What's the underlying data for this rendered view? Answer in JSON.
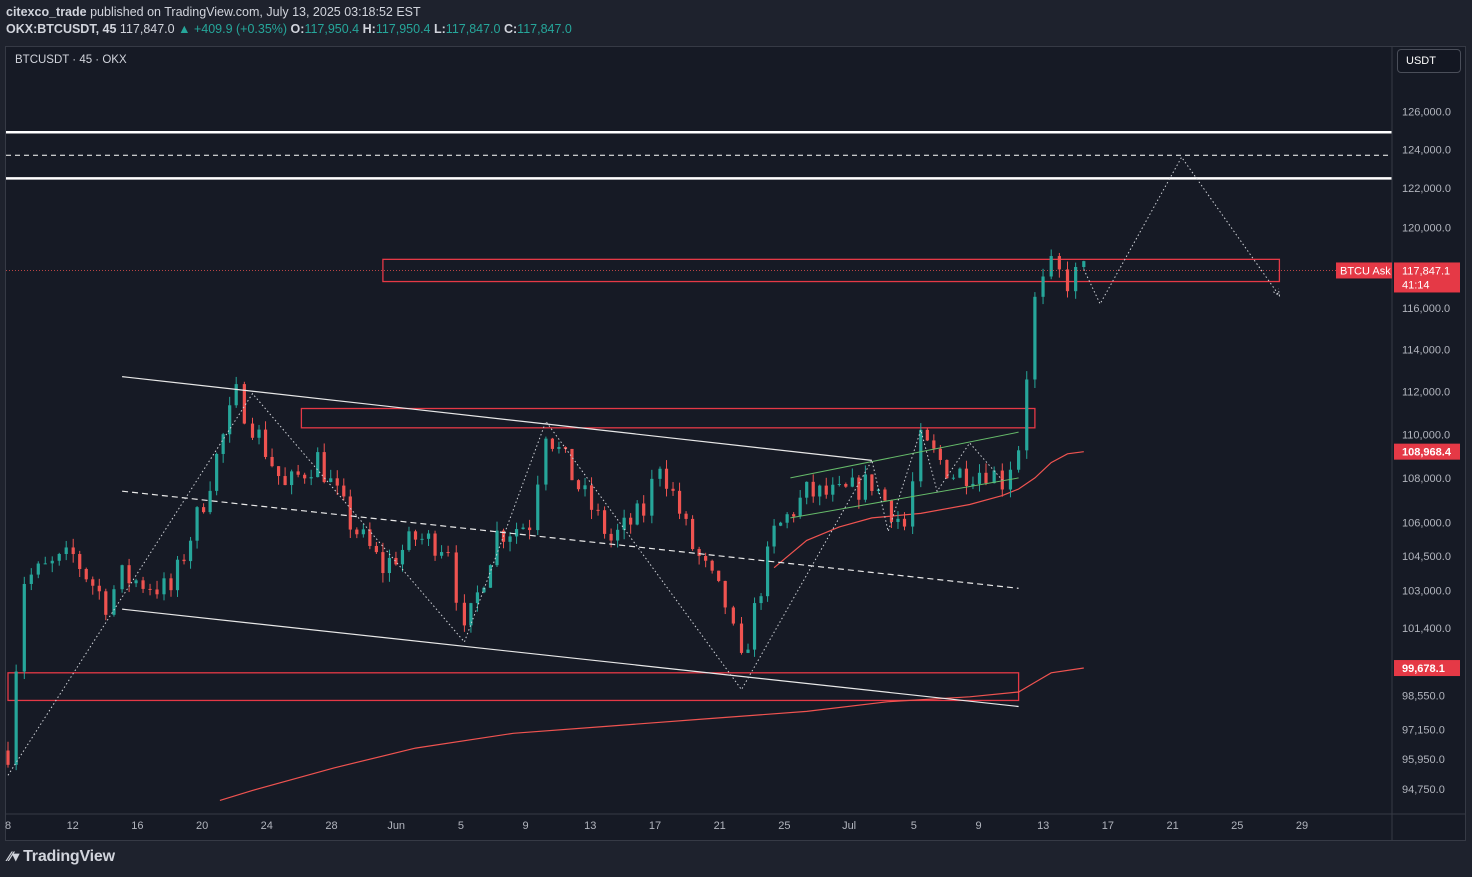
{
  "header": {
    "author": "citexco_trade",
    "published": "published on TradingView.com, July 13, 2025 03:18:52 EST",
    "symbol": "OKX:BTCUSDT, 45",
    "last": "117,847.0",
    "change": "▲ +409.9 (+0.35%)",
    "open_label": "O:",
    "open": "117,950.4",
    "high_label": "H:",
    "high": "117,950.4",
    "low_label": "L:",
    "low": "117,847.0",
    "close_label": "C:",
    "close": "117,847.0"
  },
  "chart_title": "BTCUSDT · 45 · OKX",
  "currency_button": "USDT",
  "footer": {
    "logo": "TradingView"
  },
  "colors": {
    "up": "#26a69a",
    "down": "#ef5350",
    "zone": "#e53946",
    "channel": "#66bb6a",
    "white": "#ffffff",
    "axis_text": "#b2b5be"
  },
  "chart_data": {
    "type": "line",
    "title": "BTCUSDT · 45 · OKX",
    "xlabel": "",
    "ylabel": "",
    "y_scale": "log",
    "ylim": [
      94000,
      128000
    ],
    "y_ticks": [
      "126,000.0",
      "124,000.0",
      "122,000.0",
      "120,000.0",
      "116,000.0",
      "114,000.0",
      "112,000.0",
      "110,000.0",
      "108,000.0",
      "106,000.0",
      "104,500.0",
      "103,000.0",
      "101,400.0",
      "98,550.0",
      "97,150.0",
      "95,950.0",
      "94,750.0"
    ],
    "x_ticks": [
      "8",
      "12",
      "16",
      "20",
      "24",
      "28",
      "Jun",
      "5",
      "9",
      "13",
      "17",
      "21",
      "25",
      "Jul",
      "5",
      "9",
      "13",
      "17",
      "21",
      "25",
      "29"
    ],
    "price_series": {
      "name": "BTCUSDT",
      "x": [
        "2025-05-08",
        "2025-05-09",
        "2025-05-12",
        "2025-05-14",
        "2025-05-15",
        "2025-05-18",
        "2025-05-20",
        "2025-05-22",
        "2025-05-23",
        "2025-05-25",
        "2025-05-27",
        "2025-05-29",
        "2025-05-31",
        "2025-06-02",
        "2025-06-04",
        "2025-06-05",
        "2025-06-07",
        "2025-06-09",
        "2025-06-10",
        "2025-06-12",
        "2025-06-14",
        "2025-06-16",
        "2025-06-17",
        "2025-06-19",
        "2025-06-21",
        "2025-06-22",
        "2025-06-24",
        "2025-06-26",
        "2025-06-28",
        "2025-06-30",
        "2025-07-02",
        "2025-07-03",
        "2025-07-05",
        "2025-07-07",
        "2025-07-08",
        "2025-07-09",
        "2025-07-10",
        "2025-07-11",
        "2025-07-12",
        "2025-07-13"
      ],
      "y": [
        96300,
        103500,
        104500,
        102500,
        103600,
        103000,
        107000,
        111800,
        110500,
        107500,
        108900,
        106000,
        104000,
        105300,
        105000,
        101000,
        105500,
        106000,
        110300,
        107600,
        105200,
        106500,
        108800,
        104900,
        102400,
        99800,
        105500,
        107300,
        107200,
        107800,
        105800,
        109600,
        108200,
        108400,
        107900,
        109500,
        116300,
        117900,
        117300,
        117847
      ]
    },
    "forecast_path": {
      "x": [
        "2025-07-13",
        "2025-07-14",
        "2025-07-19",
        "2025-07-25"
      ],
      "y": [
        117900,
        116200,
        123600,
        116600
      ]
    },
    "ma_fast": {
      "x": [
        "2025-06-24",
        "2025-06-26",
        "2025-06-28",
        "2025-06-30",
        "2025-07-03",
        "2025-07-06",
        "2025-07-08",
        "2025-07-09",
        "2025-07-10",
        "2025-07-11",
        "2025-07-12",
        "2025-07-13"
      ],
      "y": [
        104000,
        105200,
        105800,
        106200,
        106400,
        106800,
        107200,
        107500,
        108000,
        108700,
        109100,
        109200
      ]
    },
    "ma_slow": {
      "x": [
        "2025-05-21",
        "2025-05-23",
        "2025-05-28",
        "2025-06-02",
        "2025-06-08",
        "2025-06-14",
        "2025-06-20",
        "2025-06-26",
        "2025-07-01",
        "2025-07-06",
        "2025-07-09",
        "2025-07-10",
        "2025-07-11",
        "2025-07-13"
      ],
      "y": [
        94300,
        94700,
        95600,
        96400,
        97000,
        97300,
        97600,
        97900,
        98300,
        98500,
        98700,
        99100,
        99500,
        99700
      ]
    },
    "horizontal_levels": [
      {
        "price": 124900,
        "style": "solid"
      },
      {
        "price": 123700,
        "style": "dashed"
      },
      {
        "price": 122500,
        "style": "solid"
      }
    ],
    "zones": [
      {
        "from": "2025-05-31",
        "to": "2025-07-25",
        "low": 117300,
        "high": 118400
      },
      {
        "from": "2025-05-26",
        "to": "2025-07-10",
        "low": 110300,
        "high": 111200
      },
      {
        "from": "2025-05-08",
        "to": "2025-07-09",
        "low": 98350,
        "high": 99500
      }
    ],
    "trendlines": [
      {
        "name": "upper",
        "from": [
          "2025-05-15",
          112700
        ],
        "to": [
          "2025-06-30",
          108800
        ],
        "style": "solid"
      },
      {
        "name": "lower",
        "from": [
          "2025-05-15",
          102200
        ],
        "to": [
          "2025-07-09",
          98100
        ],
        "style": "solid"
      },
      {
        "name": "mid",
        "from": [
          "2025-05-15",
          107400
        ],
        "to": [
          "2025-07-09",
          103100
        ],
        "style": "dashed"
      },
      {
        "name": "ascending-channel-top",
        "from": [
          "2025-06-25",
          108000
        ],
        "to": [
          "2025-07-09",
          110100
        ],
        "style": "solid"
      },
      {
        "name": "ascending-channel-bottom",
        "from": [
          "2025-06-25",
          106200
        ],
        "to": [
          "2025-07-09",
          108000
        ],
        "style": "solid"
      }
    ],
    "zigzag": {
      "x": [
        "2025-05-08",
        "2025-05-23",
        "2025-06-05",
        "2025-06-10",
        "2025-06-22",
        "2025-06-30",
        "2025-07-01",
        "2025-07-03",
        "2025-07-04",
        "2025-07-06",
        "2025-07-08"
      ],
      "y": [
        95300,
        111900,
        100800,
        110600,
        98800,
        108800,
        105600,
        110200,
        107400,
        109600,
        107900
      ]
    },
    "price_labels": [
      {
        "text": "BTCU Ask",
        "value": "117,847.1",
        "sub": "41:14"
      },
      {
        "value": "108,968.4"
      },
      {
        "value": "99,678.1"
      }
    ]
  }
}
